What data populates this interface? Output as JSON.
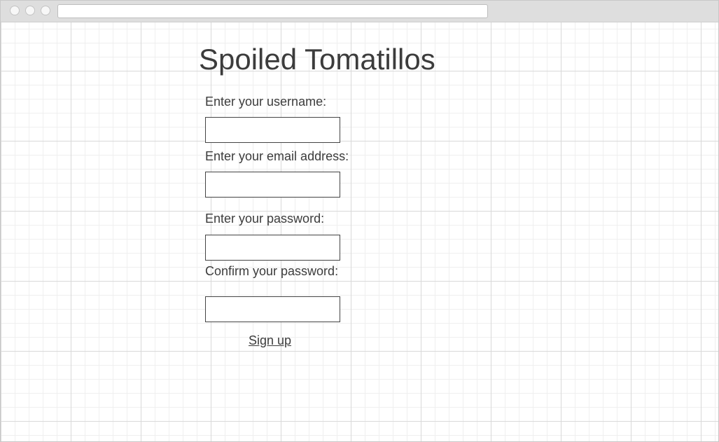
{
  "page": {
    "title": "Spoiled Tomatillos"
  },
  "form": {
    "username_label": "Enter your username:",
    "username_value": "",
    "email_label": "Enter your email address:",
    "email_value": "",
    "password_label": "Enter your password:",
    "password_value": "",
    "confirm_label": "Confirm your password:",
    "confirm_value": "",
    "submit_label": "Sign up"
  }
}
